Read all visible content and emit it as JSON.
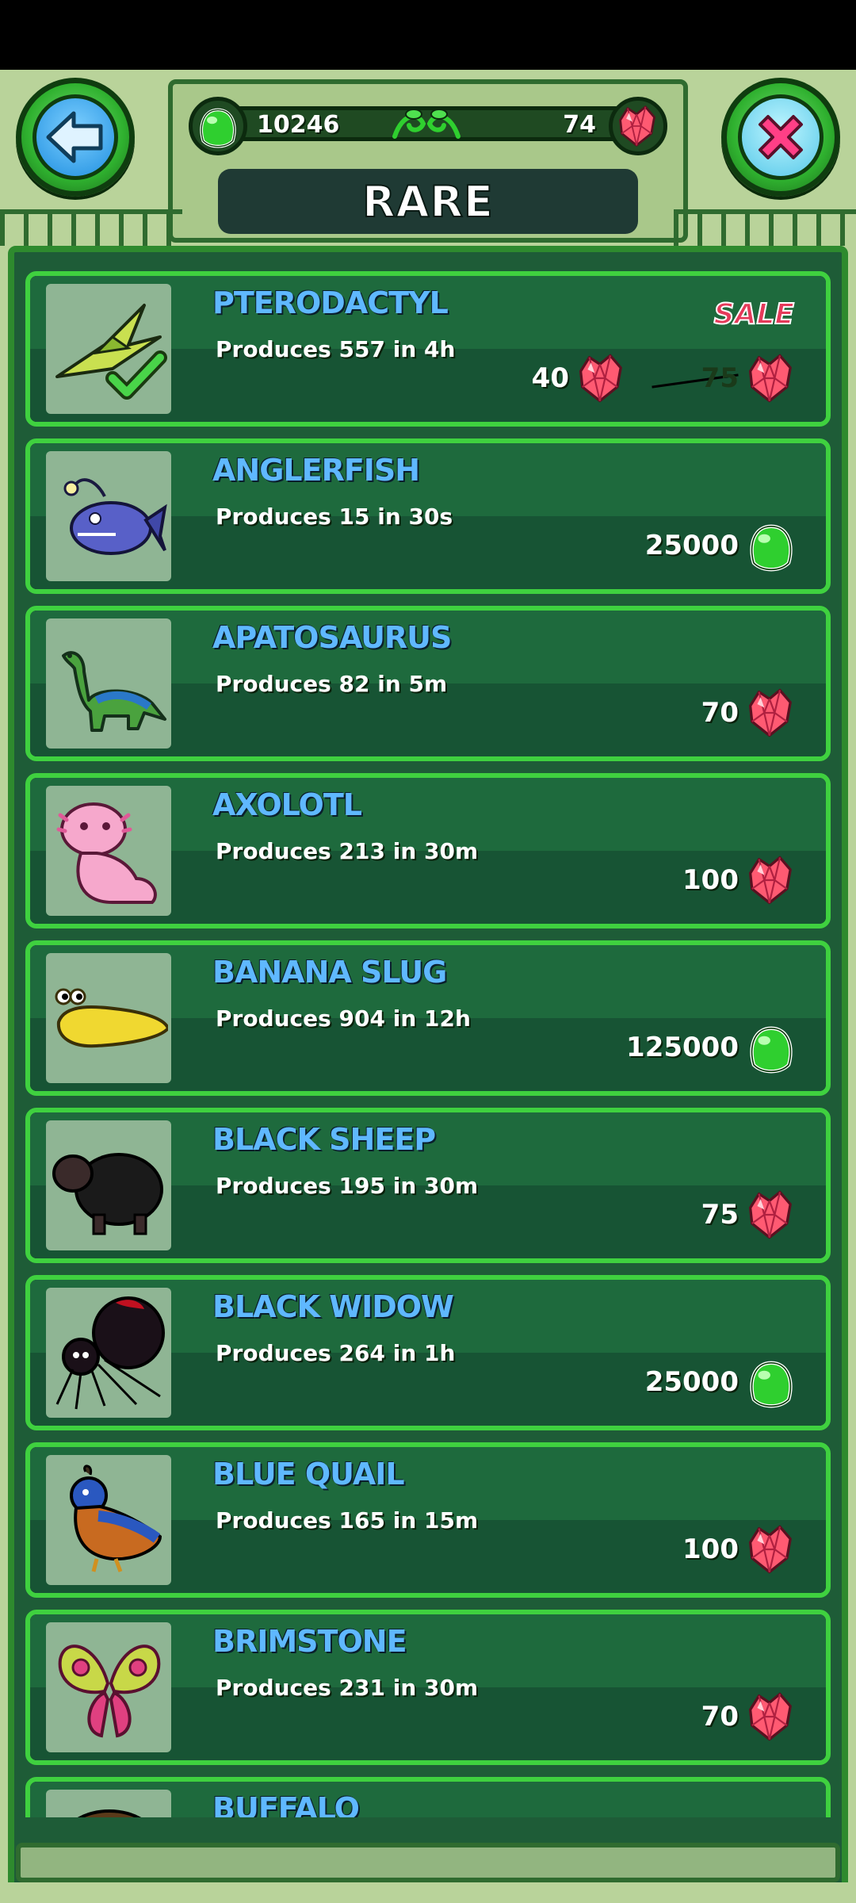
{
  "header": {
    "beans_count": "10246",
    "gems_count": "74",
    "title": "RARE"
  },
  "colors": {
    "item_border": "#3fd13f",
    "name_text": "#5fb8ff",
    "sale_text": "#e53a5a",
    "panel_bg": "#1e5c37"
  },
  "items": [
    {
      "name": "PTERODACTYL",
      "produces": "Produces 557 in 4h",
      "sale_label": "SALE",
      "new_price": "40",
      "old_price": "75",
      "currency_icon": "gem-icon"
    },
    {
      "name": "ANGLERFISH",
      "produces": "Produces 15 in 30s",
      "price": "25000",
      "currency_icon": "bean-icon"
    },
    {
      "name": "APATOSAURUS",
      "produces": "Produces 82 in 5m",
      "price": "70",
      "currency_icon": "gem-icon"
    },
    {
      "name": "AXOLOTL",
      "produces": "Produces 213 in 30m",
      "price": "100",
      "currency_icon": "gem-icon"
    },
    {
      "name": "BANANA SLUG",
      "produces": "Produces 904 in 12h",
      "price": "125000",
      "currency_icon": "bean-icon"
    },
    {
      "name": "BLACK SHEEP",
      "produces": "Produces 195 in 30m",
      "price": "75",
      "currency_icon": "gem-icon"
    },
    {
      "name": "BLACK WIDOW",
      "produces": "Produces 264 in 1h",
      "price": "25000",
      "currency_icon": "bean-icon"
    },
    {
      "name": "BLUE QUAIL",
      "produces": "Produces 165 in 15m",
      "price": "100",
      "currency_icon": "gem-icon"
    },
    {
      "name": "BRIMSTONE",
      "produces": "Produces 231 in 30m",
      "price": "70",
      "currency_icon": "gem-icon"
    },
    {
      "name": "BUFFALO"
    }
  ]
}
